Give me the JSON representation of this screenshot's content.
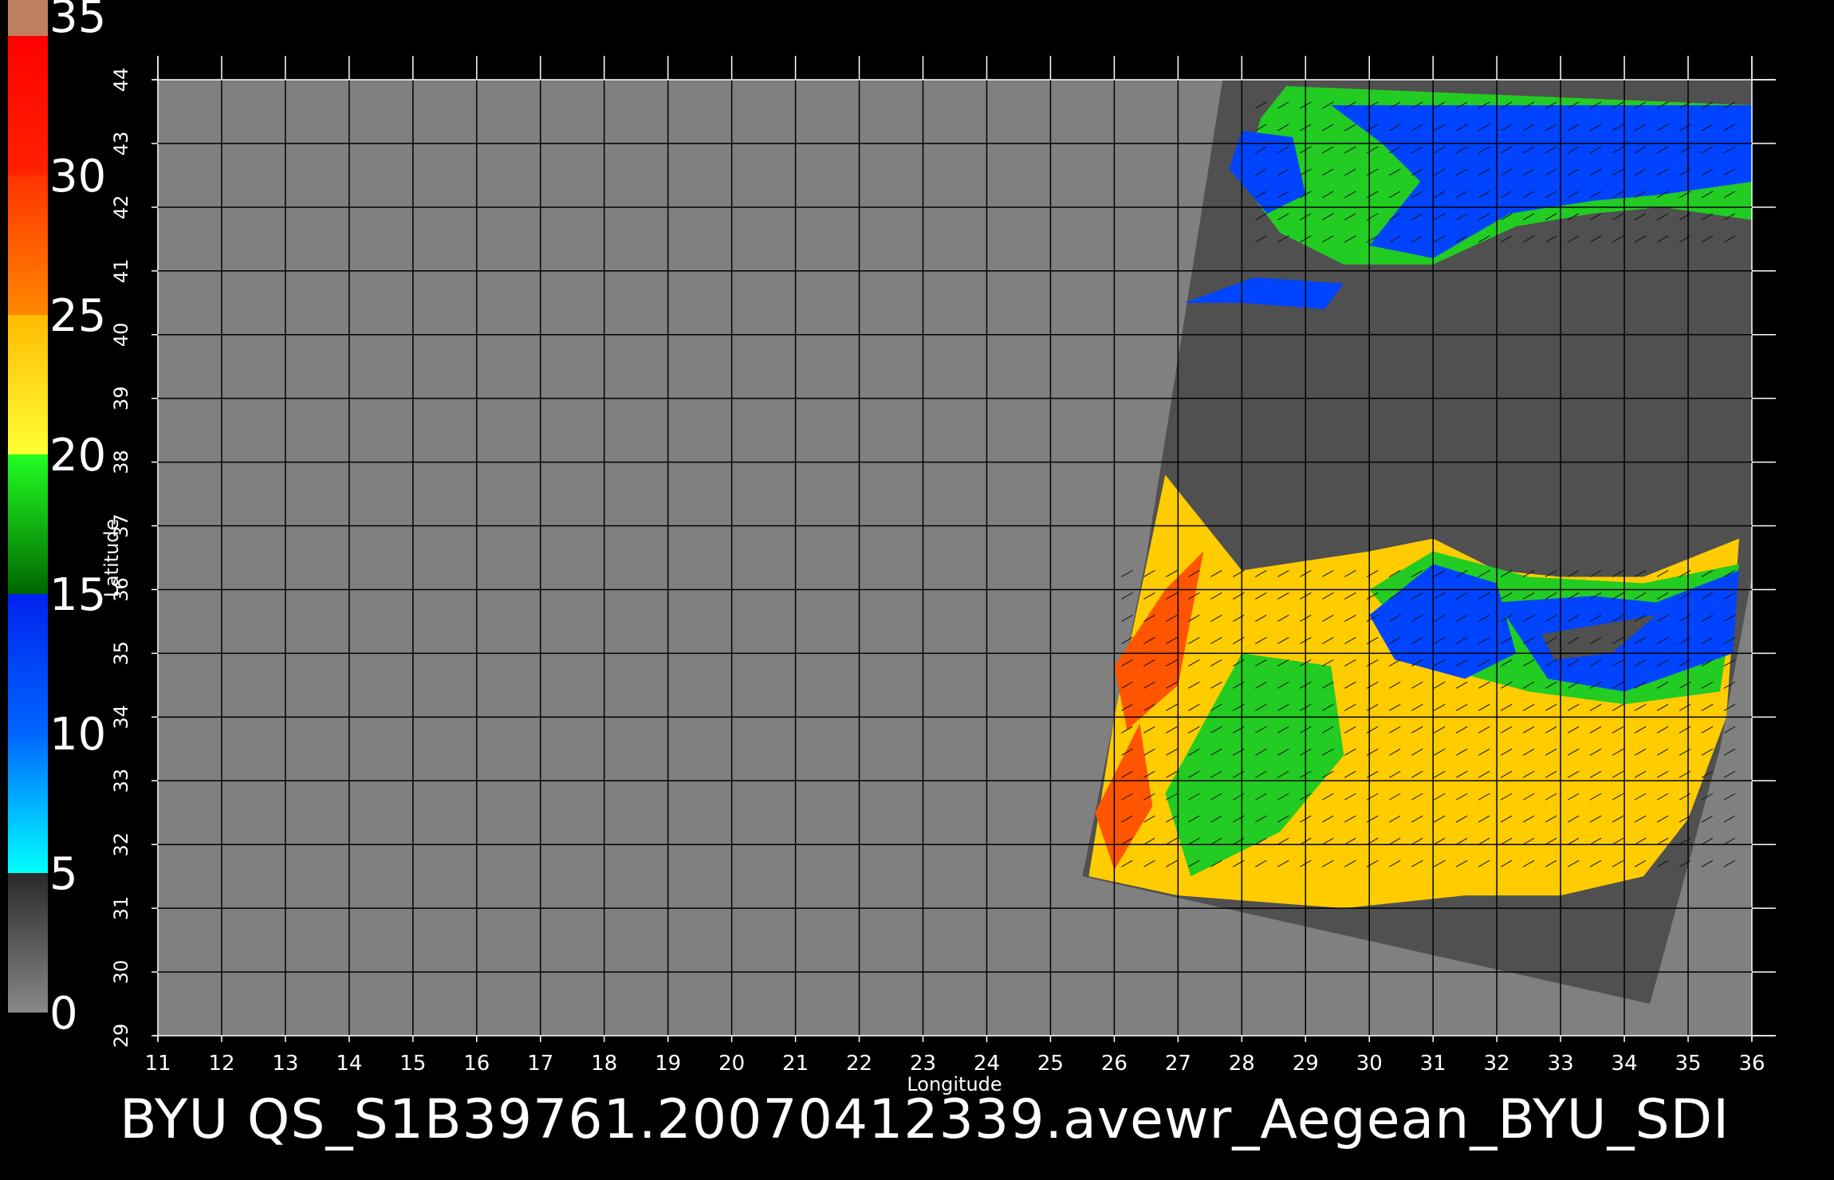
{
  "title": "BYU  QS_S1B39761.20070412339.avewr_Aegean_BYU_SDI",
  "axes": {
    "xlabel": "Longitude",
    "ylabel": "Latitude",
    "lon_range": [
      11,
      36
    ],
    "lat_range": [
      29,
      44
    ],
    "lon_ticks": [
      "11",
      "12",
      "13",
      "14",
      "15",
      "16",
      "17",
      "18",
      "19",
      "20",
      "21",
      "22",
      "23",
      "24",
      "25",
      "26",
      "27",
      "28",
      "29",
      "30",
      "31",
      "32",
      "33",
      "34",
      "35",
      "36"
    ],
    "lat_ticks": [
      "29",
      "30",
      "31",
      "32",
      "33",
      "34",
      "35",
      "36",
      "37",
      "38",
      "39",
      "40",
      "41",
      "42",
      "43",
      "44"
    ]
  },
  "colorbar": {
    "labels": [
      "0",
      "5",
      "10",
      "15",
      "20",
      "25",
      "30",
      "35"
    ],
    "range": [
      0,
      35
    ],
    "bands": [
      {
        "from": 0,
        "to": 5,
        "colors": [
          "#888888",
          "#2a2a2a"
        ]
      },
      {
        "from": 5,
        "to": 10,
        "colors": [
          "#00ffff",
          "#0066ff"
        ]
      },
      {
        "from": 10,
        "to": 15,
        "colors": [
          "#0066ff",
          "#0022ee"
        ]
      },
      {
        "from": 15,
        "to": 20,
        "colors": [
          "#006600",
          "#22ff22"
        ]
      },
      {
        "from": 20,
        "to": 25,
        "colors": [
          "#ffff33",
          "#ffbb00"
        ]
      },
      {
        "from": 25,
        "to": 30,
        "colors": [
          "#ff8800",
          "#ff3300"
        ]
      },
      {
        "from": 30,
        "to": 35,
        "colors": [
          "#ff2200",
          "#ff0000"
        ]
      },
      {
        "from": 35,
        "to": 36,
        "colors": [
          "#c08060",
          "#c08060"
        ]
      }
    ]
  },
  "colors": {
    "background": "#000000",
    "ocean_nodata": "#808080",
    "land_mask": "#505050",
    "grid": "#000000",
    "wind_low": "#0044ff",
    "wind_mid": "#22cc22",
    "wind_high": "#ffcc00",
    "wind_max": "#ff5500"
  }
}
